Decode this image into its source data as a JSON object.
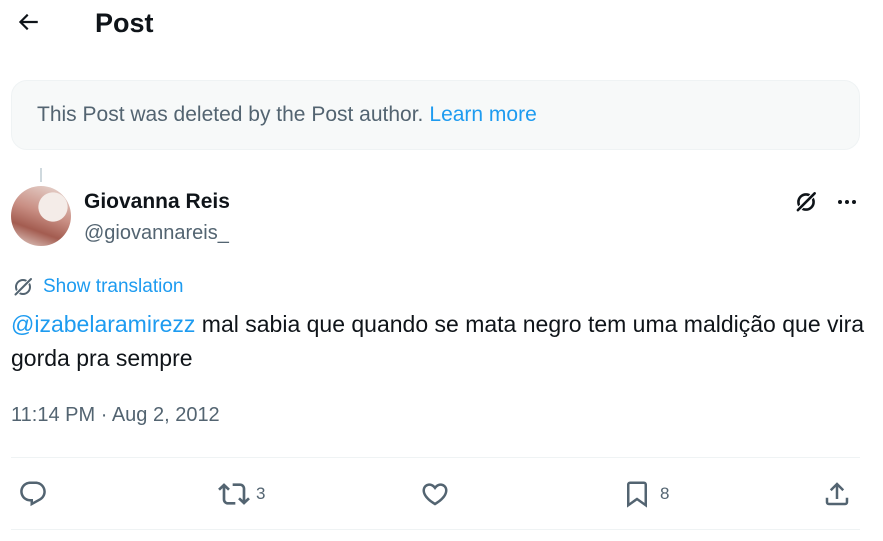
{
  "header": {
    "title": "Post",
    "back_icon": "arrow-left-icon"
  },
  "deleted_notice": {
    "text": "This Post was deleted by the Post author.",
    "link": "Learn more"
  },
  "author": {
    "display_name": "Giovanna Reis",
    "handle": "@giovannareis_"
  },
  "translation": {
    "label": "Show translation"
  },
  "tweet": {
    "mention": "@izabelaramirezz",
    "text": "mal sabia que quando se mata negro tem uma maldição que vira gorda pra sempre"
  },
  "meta": {
    "time": "11:14 PM",
    "separator": "·",
    "date": "Aug 2, 2012"
  },
  "actions": {
    "reply_count": "",
    "repost_count": "3",
    "like_count": "",
    "bookmark_count": "8"
  },
  "colors": {
    "accent": "#1d9bf0",
    "text": "#0f1419",
    "secondary": "#536471",
    "notice_bg": "#f7f9f9"
  }
}
